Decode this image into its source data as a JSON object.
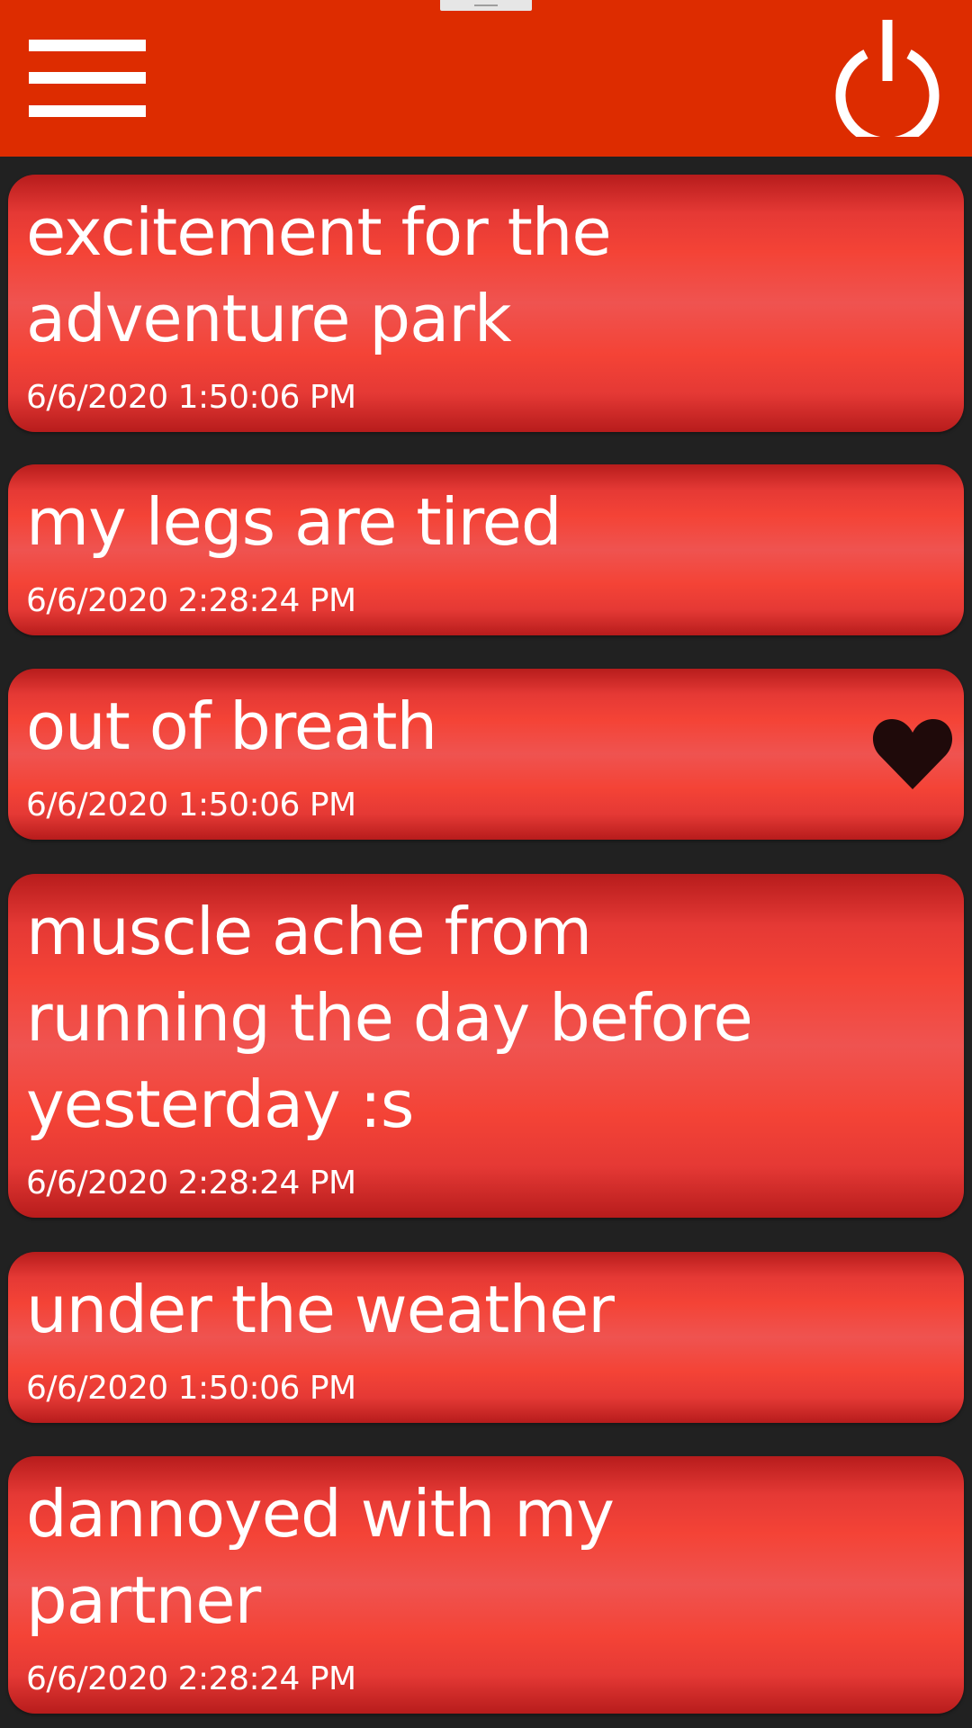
{
  "app_bar": {
    "background_color": "#dd2c00",
    "menu_icon": "hamburger-menu-icon",
    "power_icon": "power-icon"
  },
  "entries": [
    {
      "title": "excitement for the\nadventure park",
      "timestamp": "6/6/2020 1:50:06 PM",
      "favorite": false
    },
    {
      "title": "my legs are tired",
      "timestamp": "6/6/2020 2:28:24 PM",
      "favorite": false
    },
    {
      "title": "out of breath",
      "timestamp": "6/6/2020 1:50:06 PM",
      "favorite": true
    },
    {
      "title": "muscle ache from\nrunning the day before\nyesterday :s",
      "timestamp": "6/6/2020 2:28:24 PM",
      "favorite": false
    },
    {
      "title": "under the weather",
      "timestamp": "6/6/2020 1:50:06 PM",
      "favorite": false
    },
    {
      "title": "dannoyed with my\npartner",
      "timestamp": "6/6/2020 2:28:24 PM",
      "favorite": false
    }
  ],
  "colors": {
    "card_red": "#f44336",
    "background": "#212121",
    "heart": "#1f0a0a",
    "text": "#ffffff"
  }
}
